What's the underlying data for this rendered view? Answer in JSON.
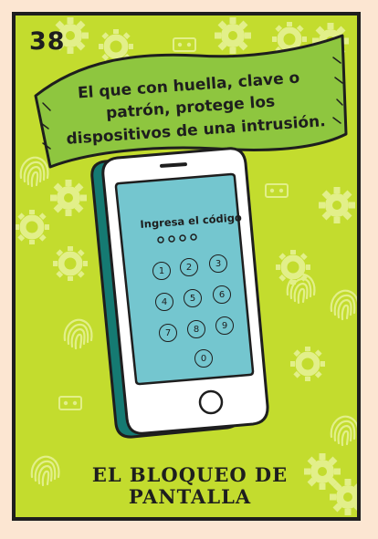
{
  "card": {
    "number": "38",
    "banner_lines": [
      "El que con huella, clave o",
      "patrón, protege los",
      "dispositivos de una intrusión."
    ],
    "title_lines": [
      "EL BLOQUEO DE",
      "PANTALLA"
    ]
  },
  "phone": {
    "prompt": "Ingresa el código",
    "pin_dots": 4,
    "keys": [
      "1",
      "2",
      "3",
      "4",
      "5",
      "6",
      "7",
      "8",
      "9",
      "0"
    ]
  },
  "colors": {
    "page": "#fce6d2",
    "card": "#c3dc2e",
    "banner": "#8ec63f",
    "phone_body": "#ffffff",
    "phone_case": "#157a72",
    "screen": "#74c6cf",
    "ink": "#1e1e1e",
    "decor": "#e2ef8a"
  },
  "icons": [
    "gear-icon",
    "fingerprint-icon",
    "password-dots-icon",
    "home-button-icon"
  ]
}
